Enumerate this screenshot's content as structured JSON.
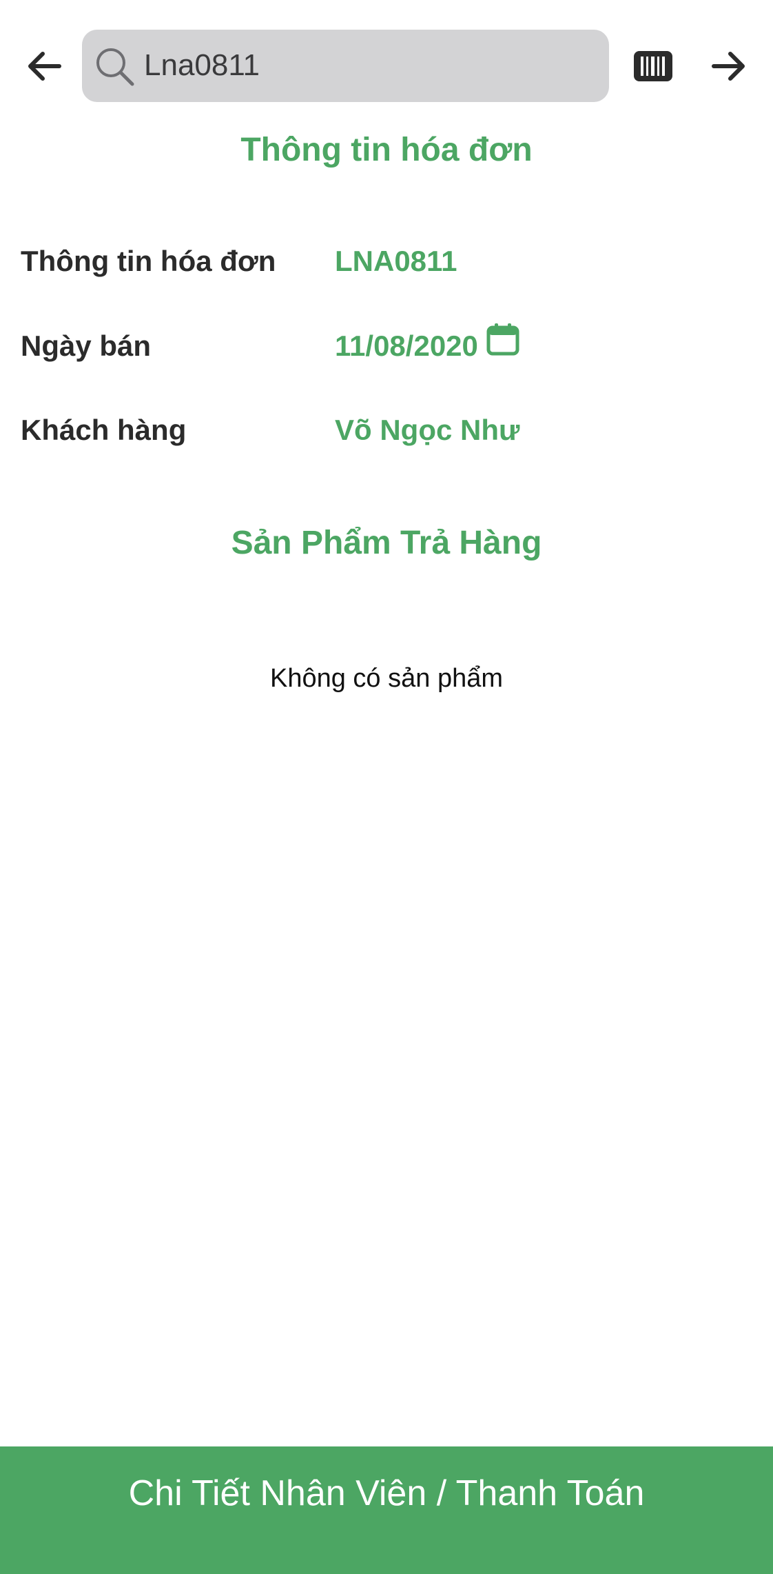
{
  "search": {
    "value": "Lna0811"
  },
  "icons": {
    "back": "arrow-left-icon",
    "search": "search-icon",
    "barcode": "barcode-icon",
    "next": "arrow-right-icon",
    "calendar": "calendar-icon"
  },
  "invoice": {
    "section_title": "Thông tin hóa đơn",
    "rows": [
      {
        "label": "Thông tin hóa đơn",
        "value": "LNA0811"
      },
      {
        "label": "Ngày bán",
        "value": "11/08/2020"
      },
      {
        "label": "Khách hàng",
        "value": "Võ Ngọc Như"
      }
    ]
  },
  "products": {
    "section_title": "Sản Phẩm Trả Hàng",
    "empty_text": "Không có sản phẩm"
  },
  "footer": {
    "button_label": "Chi Tiết Nhân Viên / Thanh Toán"
  },
  "colors": {
    "accent": "#4ca663",
    "search_bg": "#d3d3d5",
    "label_text": "#2b2b2b"
  }
}
